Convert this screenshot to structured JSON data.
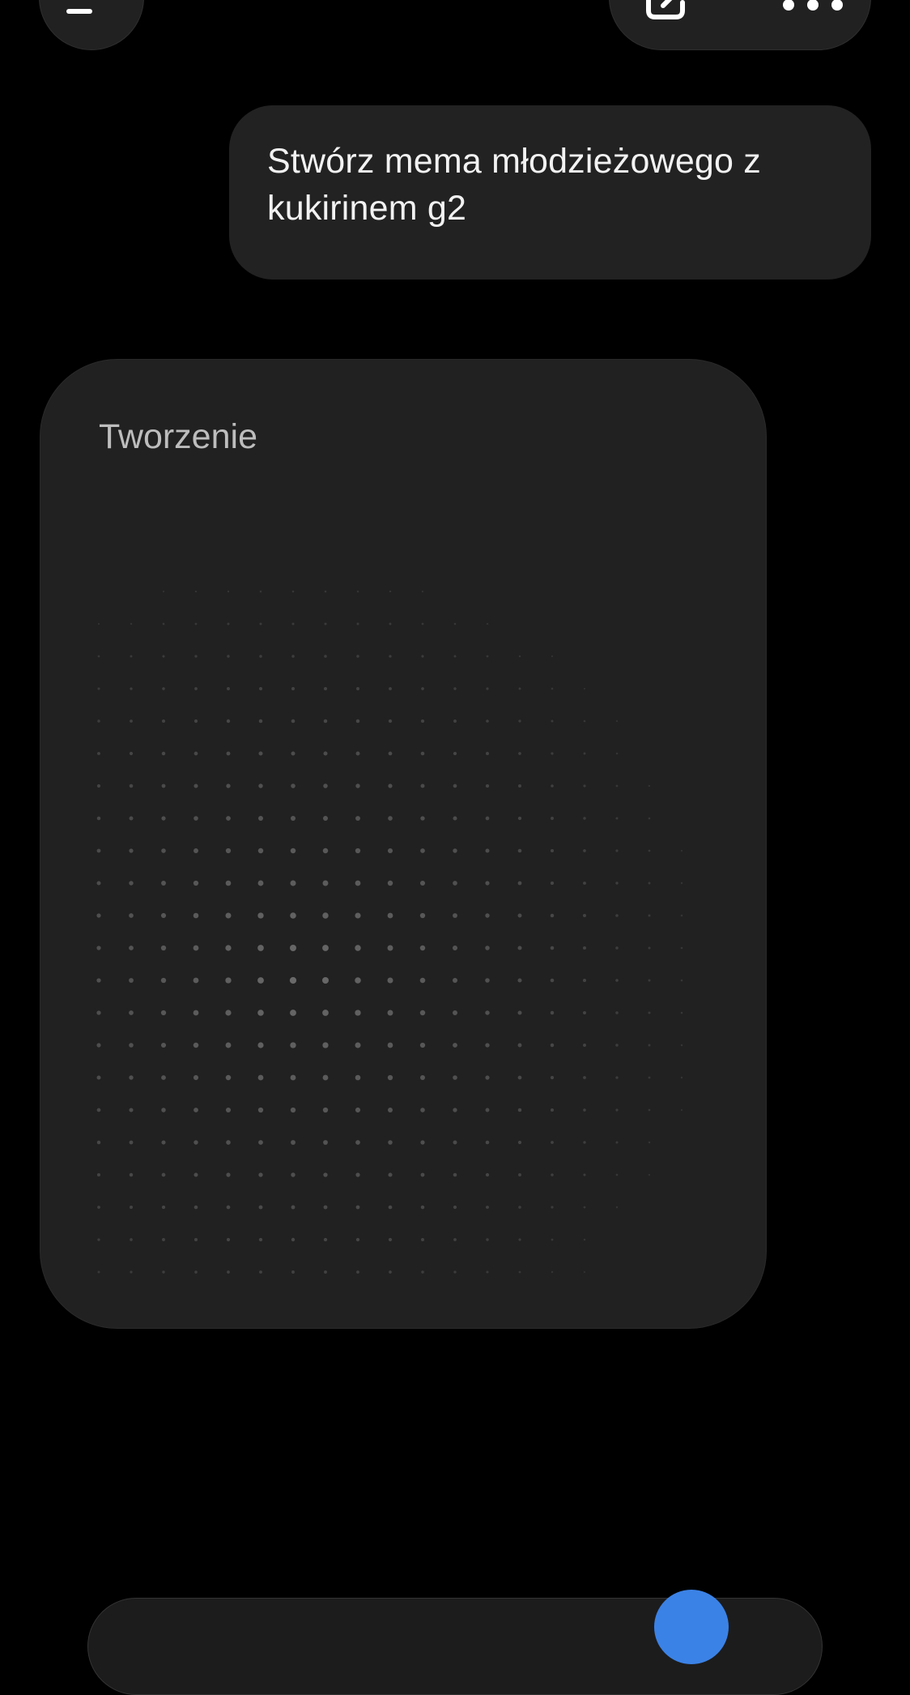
{
  "header": {
    "menu_icon": "hamburger-menu-icon",
    "actions": [
      {
        "icon": "edit-icon"
      },
      {
        "icon": "more-horizontal-icon"
      }
    ]
  },
  "conversation": {
    "user_message": "Stwórz mema młodzieżowego z kukirinem g2",
    "assistant_generation": {
      "status_label": "Tworzenie",
      "placeholder": "dot-grid-loading"
    }
  },
  "composer": {
    "send_icon": "send-icon"
  },
  "colors": {
    "background": "#000000",
    "bubble": "#222222",
    "card": "#212121",
    "accent": "#3b82e6"
  }
}
